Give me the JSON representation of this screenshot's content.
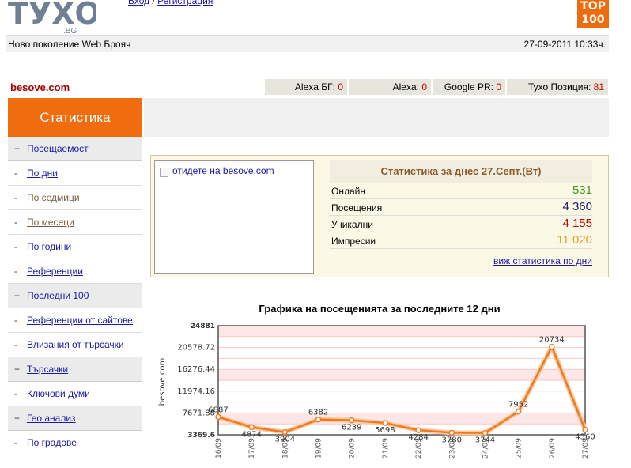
{
  "header": {
    "logo_text": "ТУХО",
    "logo_suffix": ".BG",
    "login_label": "Вход",
    "separator": " / ",
    "register_label": "Регистрация",
    "top100_line1": "TOP",
    "top100_line2": "100"
  },
  "subbar": {
    "tagline": "Ново поколение Web Брояч",
    "datetime": "27-09-2011 10:33ч."
  },
  "site": {
    "name": "besove.com",
    "alexa_bg_label": "Alexa БГ:",
    "alexa_bg_value": "0",
    "alexa_label": "Alexa:",
    "alexa_value": "0",
    "pr_label": "Google PR:",
    "pr_value": "0",
    "tyxo_label": "Тухо Позиция:",
    "tyxo_value": "81"
  },
  "sidebar": {
    "title": "Статистика",
    "items": [
      {
        "label": "Посещаемост",
        "mark": "+",
        "type": "section"
      },
      {
        "label": "По дни",
        "mark": "-",
        "type": "sub"
      },
      {
        "label": "По седмици",
        "mark": "-",
        "type": "sub",
        "visited": true
      },
      {
        "label": "По месеци",
        "mark": "-",
        "type": "sub",
        "visited": true
      },
      {
        "label": "По години",
        "mark": "-",
        "type": "sub"
      },
      {
        "label": "Референции",
        "mark": "-",
        "type": "sub"
      },
      {
        "label": "Последни 100",
        "mark": "+",
        "type": "section"
      },
      {
        "label": "Референции от сайтове",
        "mark": "-",
        "type": "sub"
      },
      {
        "label": "Влизания от търсачки",
        "mark": "-",
        "type": "sub"
      },
      {
        "label": "Търсачки",
        "mark": "+",
        "type": "section"
      },
      {
        "label": "Ключови думи",
        "mark": "-",
        "type": "sub"
      },
      {
        "label": "Гео анализ",
        "mark": "+",
        "type": "section"
      },
      {
        "label": "По градове",
        "mark": "-",
        "type": "sub"
      }
    ]
  },
  "panel": {
    "image_alt": "отидете на besove.com",
    "stats_title": "Статистика за днес 27.Септ.(Вт)",
    "rows": [
      {
        "label": "Онлайн",
        "value": "531",
        "color": "#3a9a1a"
      },
      {
        "label": "Посещения",
        "value": "4 360",
        "color": "#1a1a6a"
      },
      {
        "label": "Уникални",
        "value": "4 155",
        "color": "#c00000"
      },
      {
        "label": "Импресии",
        "value": "11 020",
        "color": "#e0a030"
      }
    ],
    "daily_link": "виж статистика по дни"
  },
  "chart_data": {
    "type": "line",
    "title": "Графика на посещенията за последните 12 дни",
    "ylabel": "besove.com",
    "categories": [
      "16/09",
      "17/09",
      "18/09",
      "19/09",
      "20/09",
      "21/09",
      "22/09",
      "23/09",
      "24/09",
      "25/09",
      "26/09",
      "27/09"
    ],
    "values": [
      6887,
      4874,
      3904,
      6382,
      6239,
      5698,
      4284,
      3780,
      3744,
      7952,
      20734,
      4360
    ],
    "ylim": [
      3369.6,
      24881
    ],
    "yticks": [
      "24881",
      "20578.72",
      "16276.44",
      "11974.16",
      "7671.88",
      "3369.6"
    ],
    "line_color": "#f07a1e",
    "grid": true
  }
}
